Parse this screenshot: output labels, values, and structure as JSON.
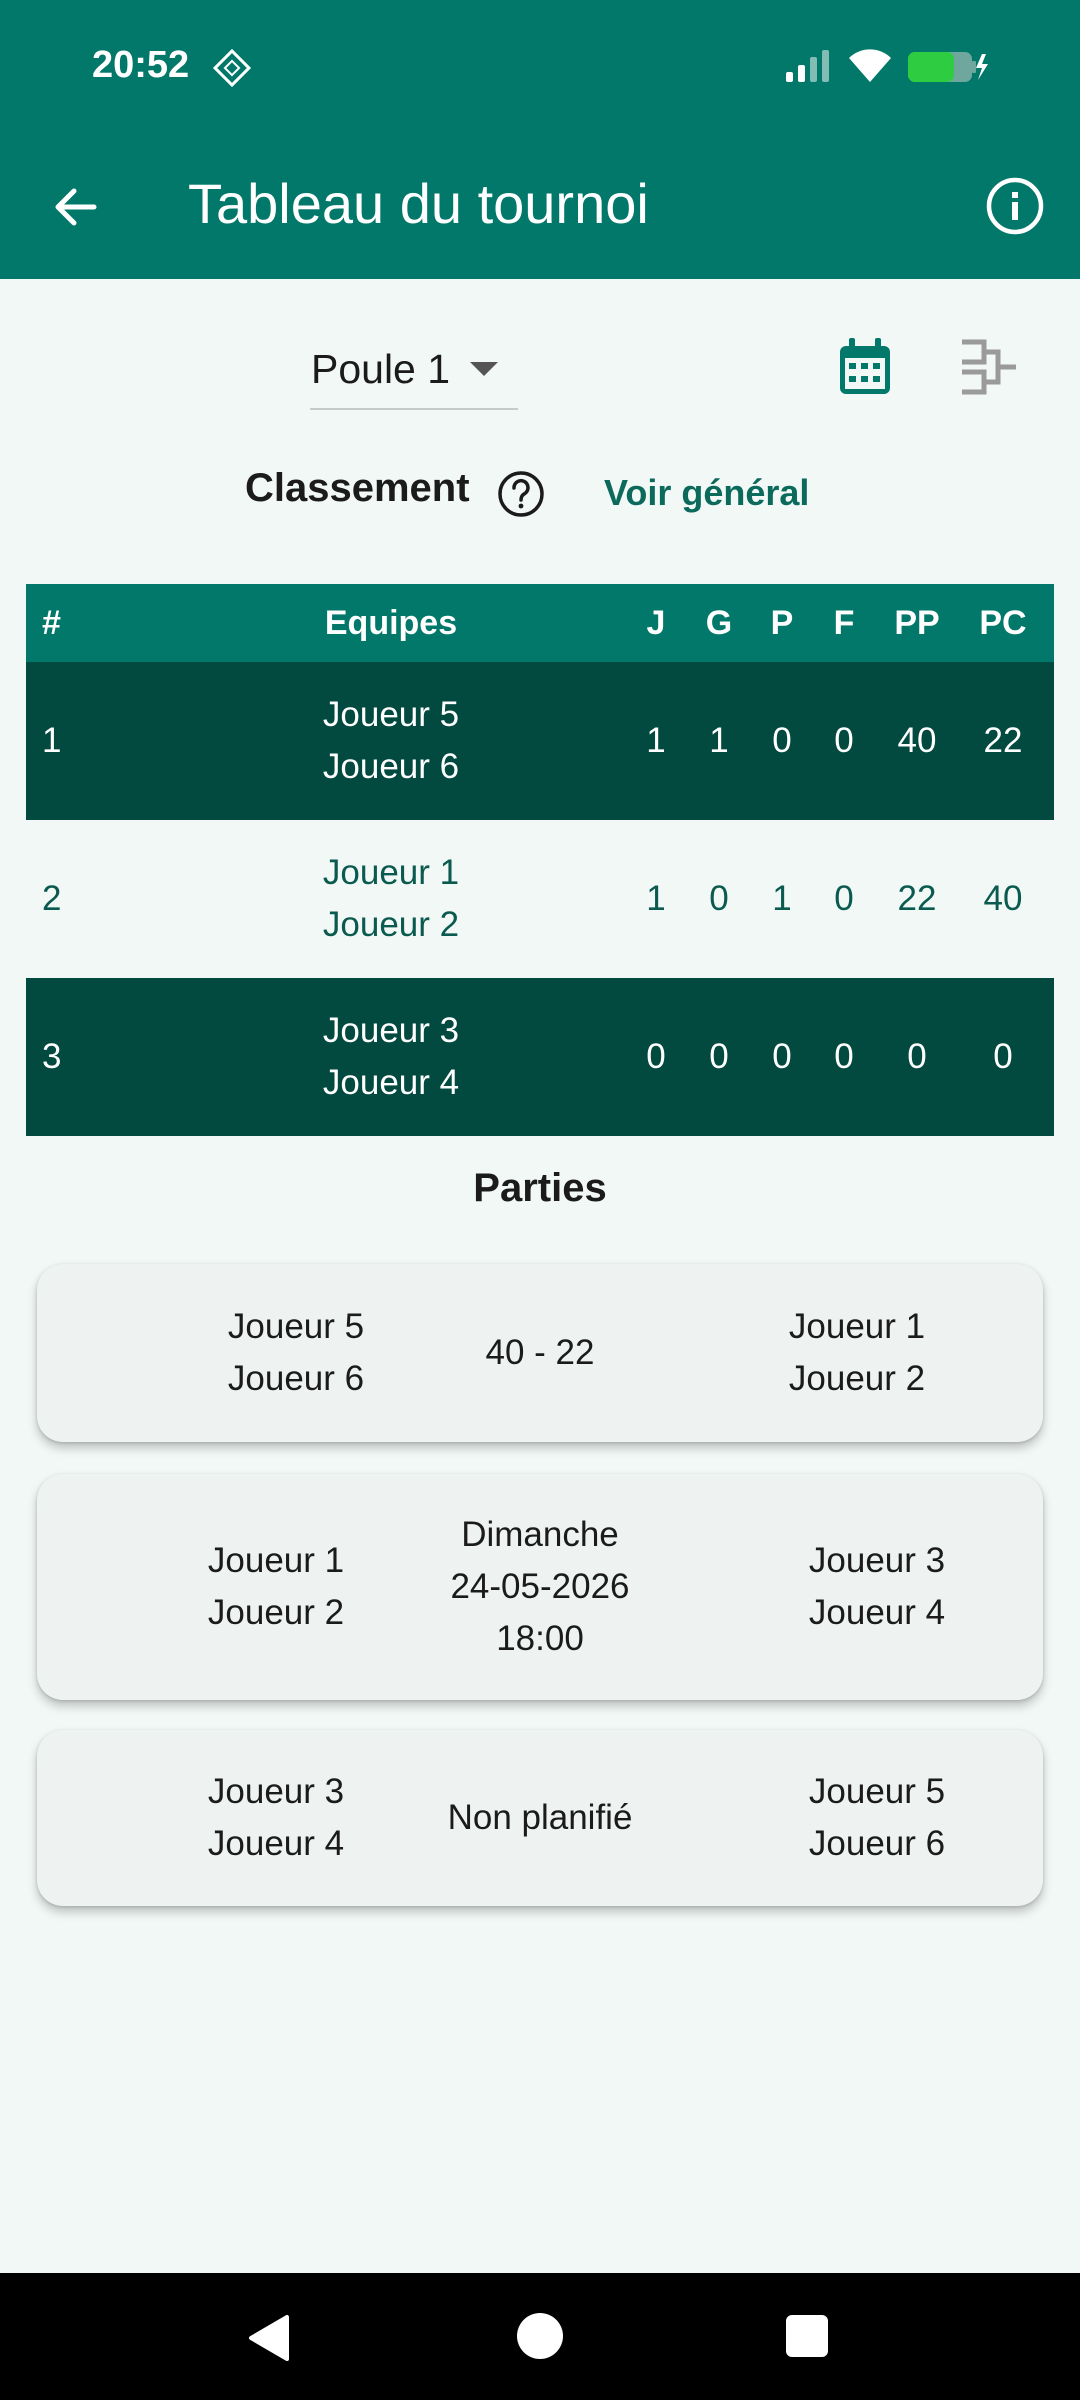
{
  "status_bar": {
    "time": "20:52"
  },
  "app_bar": {
    "title": "Tableau du tournoi"
  },
  "pool_selector": {
    "selected": "Poule 1"
  },
  "ranking": {
    "title": "Classement",
    "link": "Voir général",
    "headers": {
      "rank": "#",
      "teams": "Equipes",
      "j": "J",
      "g": "G",
      "p": "P",
      "f": "F",
      "pp": "PP",
      "pc": "PC"
    },
    "rows": [
      {
        "rank": "1",
        "player_a": "Joueur 5",
        "player_b": "Joueur 6",
        "j": "1",
        "g": "1",
        "p": "0",
        "f": "0",
        "pp": "40",
        "pc": "22"
      },
      {
        "rank": "2",
        "player_a": "Joueur 1",
        "player_b": "Joueur 2",
        "j": "1",
        "g": "0",
        "p": "1",
        "f": "0",
        "pp": "22",
        "pc": "40"
      },
      {
        "rank": "3",
        "player_a": "Joueur 3",
        "player_b": "Joueur 4",
        "j": "0",
        "g": "0",
        "p": "0",
        "f": "0",
        "pp": "0",
        "pc": "0"
      }
    ]
  },
  "matches": {
    "title": "Parties",
    "items": [
      {
        "home_a": "Joueur 5",
        "home_b": "Joueur 6",
        "info_1": "40 - 22",
        "away_a": "Joueur 1",
        "away_b": "Joueur 2"
      },
      {
        "home_a": "Joueur 1",
        "home_b": "Joueur 2",
        "info_1": "Dimanche",
        "info_2": "24-05-2026",
        "info_3": "18:00",
        "away_a": "Joueur 3",
        "away_b": "Joueur 4"
      },
      {
        "home_a": "Joueur 3",
        "home_b": "Joueur 4",
        "info_1": "Non planifié",
        "away_a": "Joueur 5",
        "away_b": "Joueur 6"
      }
    ]
  },
  "colors": {
    "primary": "#02786a",
    "row_dark": "#02493f",
    "background": "#f2f8f6",
    "link": "#0b6a5c",
    "battery": "#2ecc40"
  },
  "icons": [
    "back-arrow-icon",
    "info-icon",
    "calendar-icon",
    "bracket-icon",
    "help-icon",
    "dropdown-caret-icon"
  ]
}
